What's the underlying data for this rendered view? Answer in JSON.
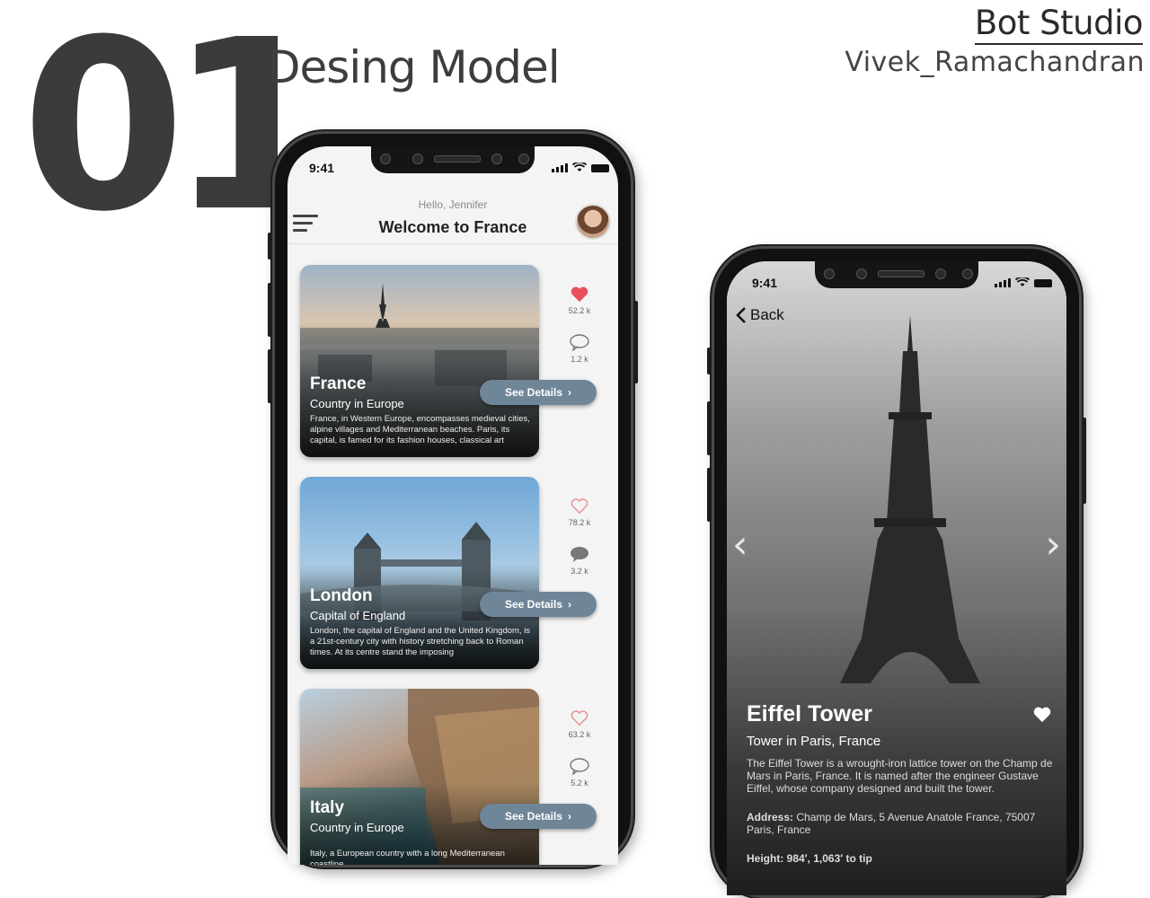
{
  "header": {
    "number": "01",
    "title": "Desing Model",
    "studio": "Bot Studio",
    "author": "Vivek_Ramachandran"
  },
  "phone1": {
    "time": "9:41",
    "greeting": "Hello, Jennifer",
    "welcome": "Welcome to France",
    "cards": [
      {
        "name": "France",
        "subtitle": "Country in Europe",
        "description": "France, in Western Europe, encompasses medieval cities, alpine villages and Mediterranean beaches. Paris, its capital, is famed for its fashion houses, classical art",
        "button": "See Details",
        "likes": "52.2 k",
        "comments": "1.2 k",
        "liked": true
      },
      {
        "name": "London",
        "subtitle": "Capital of England",
        "description": "London, the capital of England and the United Kingdom, is a 21st-century city with history stretching back to Roman times. At its centre stand the imposing",
        "button": "See Details",
        "likes": "78.2 k",
        "comments": "3.2 k",
        "liked": false
      },
      {
        "name": "Italy",
        "subtitle": "Country in Europe",
        "description": "Italy, a European country with a long Mediterranean coastline",
        "button": "See Details",
        "likes": "63.2 k",
        "comments": "5.2 k",
        "liked": false
      }
    ]
  },
  "phone2": {
    "time": "9:41",
    "back": "Back",
    "title": "Eiffel Tower",
    "subtitle": "Tower in Paris, France",
    "description": "The Eiffel Tower is a wrought-iron lattice tower on the Champ de Mars in Paris, France. It is named after the engineer Gustave Eiffel, whose company designed and built the tower.",
    "address_label": "Address:",
    "address": "Champ de Mars, 5 Avenue Anatole France, 75007 Paris, France",
    "height": "Height: 984′, 1,063′ to tip"
  },
  "colors": {
    "heart_active": "#e8505b",
    "heart_outline": "#e88a8f",
    "button": "#6f8598"
  }
}
